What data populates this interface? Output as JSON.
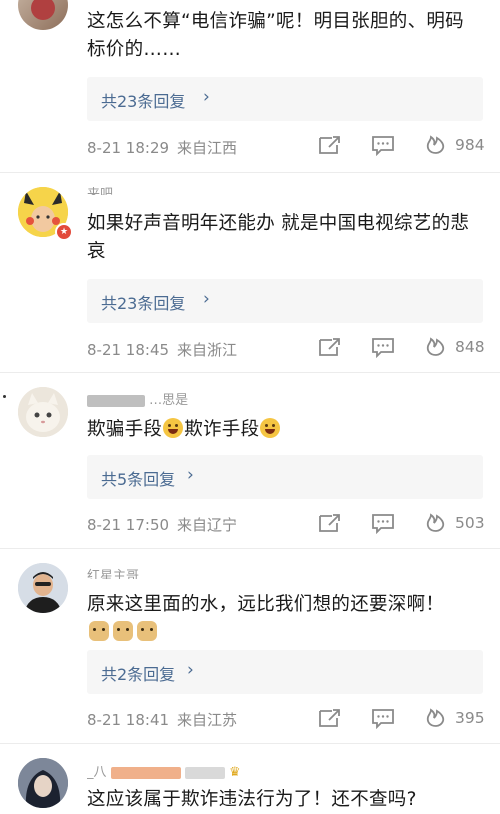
{
  "comments": [
    {
      "text": "这怎么不算“电信诈骗”呢！明目张胆的、明码标价的……",
      "reply": "共23条回复",
      "time": "8-21 18:29",
      "location": "来自江西",
      "likes": "984"
    },
    {
      "username": "来吧…",
      "text": "如果好声音明年还能办 就是中国电视综艺的悲哀",
      "reply": "共23条回复",
      "time": "8-21 18:45",
      "location": "来自浙江",
      "likes": "848"
    },
    {
      "username": "…思是",
      "text": "欺骗手段",
      "text2": "欺诈手段",
      "reply": "共5条回复",
      "time": "8-21 17:50",
      "location": "来自辽宁",
      "likes": "503"
    },
    {
      "username": "红星主哥",
      "text": "原来这里面的水，远比我们想的还要深啊！",
      "reply": "共2条回复",
      "time": "8-21 18:41",
      "location": "来自江苏",
      "likes": "395"
    },
    {
      "username": "_八",
      "text": "这应该属于欺诈违法行为了！还不查吗?"
    }
  ],
  "colors": {
    "link": "#4b6b92",
    "meta": "#8a8a8a",
    "reply_bg": "#f6f6f6"
  },
  "icons": [
    "repost-icon",
    "comment-icon",
    "like-icon",
    "chevron-right-icon"
  ]
}
